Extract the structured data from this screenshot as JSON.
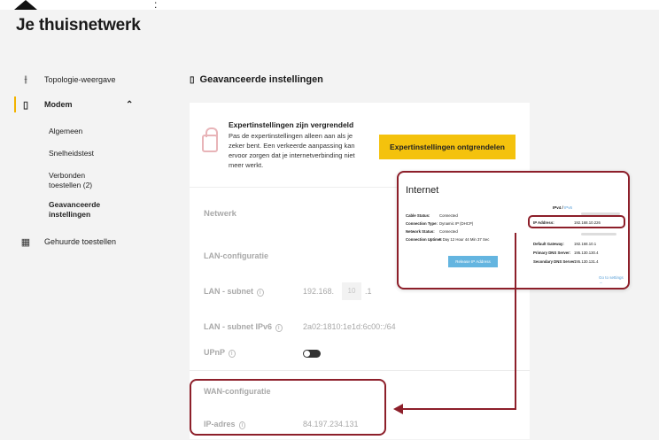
{
  "header": {
    "title": "Je thuisnetwerk",
    "dots": ":"
  },
  "sidebar": {
    "items": [
      {
        "label": "Topologie-weergave",
        "icon": "network-icon"
      },
      {
        "label": "Modem",
        "icon": "modem-icon"
      },
      {
        "label": "Gehuurde toestellen",
        "icon": "devices-icon"
      }
    ],
    "sub_items": [
      "Algemeen",
      "Snelheidstest",
      "Verbonden toestellen (2)",
      "Geavanceerde instellingen"
    ]
  },
  "section": {
    "title": "Geavanceerde instellingen"
  },
  "lock": {
    "title": "Expertinstellingen zijn vergrendeld",
    "text": "Pas de expertinstellingen alleen aan als je zeker bent. Een verkeerde aanpassing kan ervoor zorgen dat je internetverbinding niet meer werkt.",
    "button": "Expertinstellingen ontgrendelen"
  },
  "network": {
    "heading": "Netwerk",
    "lan_heading": "LAN-configuratie",
    "lan_subnet_label": "LAN - subnet",
    "lan_subnet_prefix": "192.168.",
    "lan_subnet_value": "10",
    "lan_subnet_suffix": ".1",
    "lan_ipv6_label": "LAN - subnet IPv6",
    "lan_ipv6_value": "2a02:1810:1e1d:6c00::/64",
    "upnp_label": "UPnP",
    "upnp_enabled": true,
    "wan_heading": "WAN-configuratie",
    "ip_label": "IP-adres",
    "ip_value": "84.197.234.131"
  },
  "inset": {
    "title": "Internet",
    "left": [
      {
        "k": "Cable Status:",
        "v": "Connected"
      },
      {
        "k": "Connection Type:",
        "v": "Dynamic IP (DHCP)"
      },
      {
        "k": "Network Status:",
        "v": "Connected"
      },
      {
        "k": "Connection Uptime:",
        "v": "5 Day 12 Hour 44 Min 37 Sec"
      }
    ],
    "release_button": "Release IP Address",
    "ipv4_tab": "IPv4",
    "ipv6_tab": "IPv6",
    "right": [
      {
        "k": "IP Address:",
        "v": "192.168.10.226"
      },
      {
        "k": "Default Gateway:",
        "v": "192.168.10.1"
      },
      {
        "k": "Primary DNS Server:",
        "v": "195.130.130.4"
      },
      {
        "k": "Secondary DNS Server:",
        "v": "195.130.131.4"
      }
    ],
    "settings_link": "Go to settings"
  },
  "colors": {
    "accent": "#f4c20d",
    "highlight": "#8d1f2a",
    "link": "#5aa0d8"
  }
}
